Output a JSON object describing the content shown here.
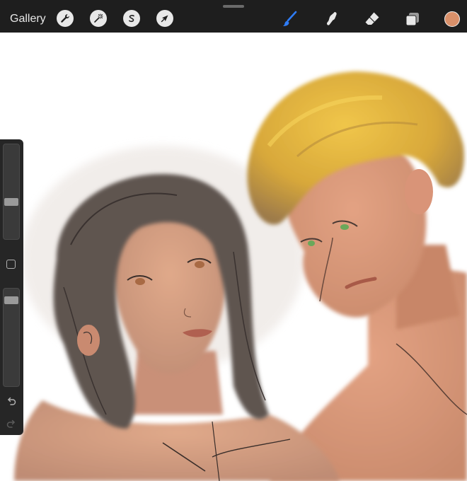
{
  "toolbar": {
    "gallery_label": "Gallery",
    "left_tools": [
      {
        "name": "actions",
        "icon": "wrench-icon"
      },
      {
        "name": "adjustments",
        "icon": "magic-wand-icon"
      },
      {
        "name": "selection",
        "icon": "selection-s-icon"
      },
      {
        "name": "transform",
        "icon": "arrow-cursor-icon"
      }
    ],
    "right_tools": [
      {
        "name": "brush",
        "icon": "brush-icon",
        "active": true
      },
      {
        "name": "smudge",
        "icon": "smudge-finger-icon"
      },
      {
        "name": "eraser",
        "icon": "eraser-icon"
      },
      {
        "name": "layers",
        "icon": "layers-icon"
      }
    ],
    "current_color": "#d9906a",
    "accent_color": "#2f7cf6"
  },
  "sidebar": {
    "brush_size_level": 0.38,
    "opacity_level": 0.92,
    "icons": [
      "modify-square-icon",
      "undo-icon",
      "redo-icon"
    ]
  }
}
